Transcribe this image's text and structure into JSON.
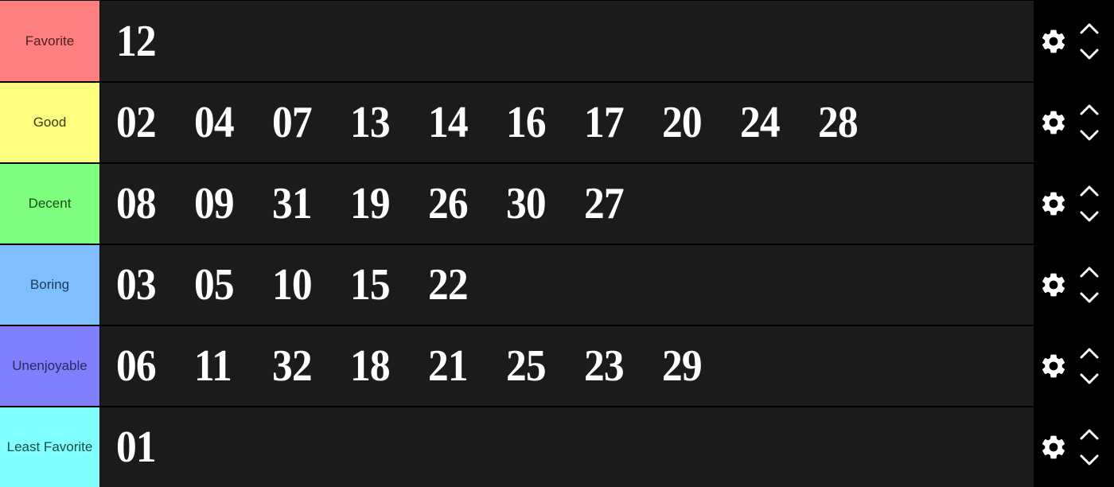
{
  "tiers": [
    {
      "label": "Favorite",
      "color": "#ff7f7f",
      "text_color": "#4a2020",
      "items": [
        "12"
      ]
    },
    {
      "label": "Good",
      "color": "#ffff7f",
      "text_color": "#3a3a10",
      "items": [
        "02",
        "04",
        "07",
        "13",
        "14",
        "16",
        "17",
        "20",
        "24",
        "28"
      ]
    },
    {
      "label": "Decent",
      "color": "#7fff7f",
      "text_color": "#1a4a1a",
      "items": [
        "08",
        "09",
        "31",
        "19",
        "26",
        "30",
        "27"
      ]
    },
    {
      "label": "Boring",
      "color": "#7fbfff",
      "text_color": "#1a3a5a",
      "items": [
        "03",
        "05",
        "10",
        "15",
        "22"
      ]
    },
    {
      "label": "Unenjoyable",
      "color": "#7f7fff",
      "text_color": "#2a2a5a",
      "items": [
        "06",
        "11",
        "32",
        "18",
        "21",
        "25",
        "23",
        "29"
      ]
    },
    {
      "label": "Least Favorite",
      "color": "#7fffff",
      "text_color": "#1a4a4a",
      "items": [
        "01"
      ]
    }
  ],
  "icons": {
    "settings": "gear-icon",
    "move_up": "chevron-up-icon",
    "move_down": "chevron-down-icon"
  }
}
